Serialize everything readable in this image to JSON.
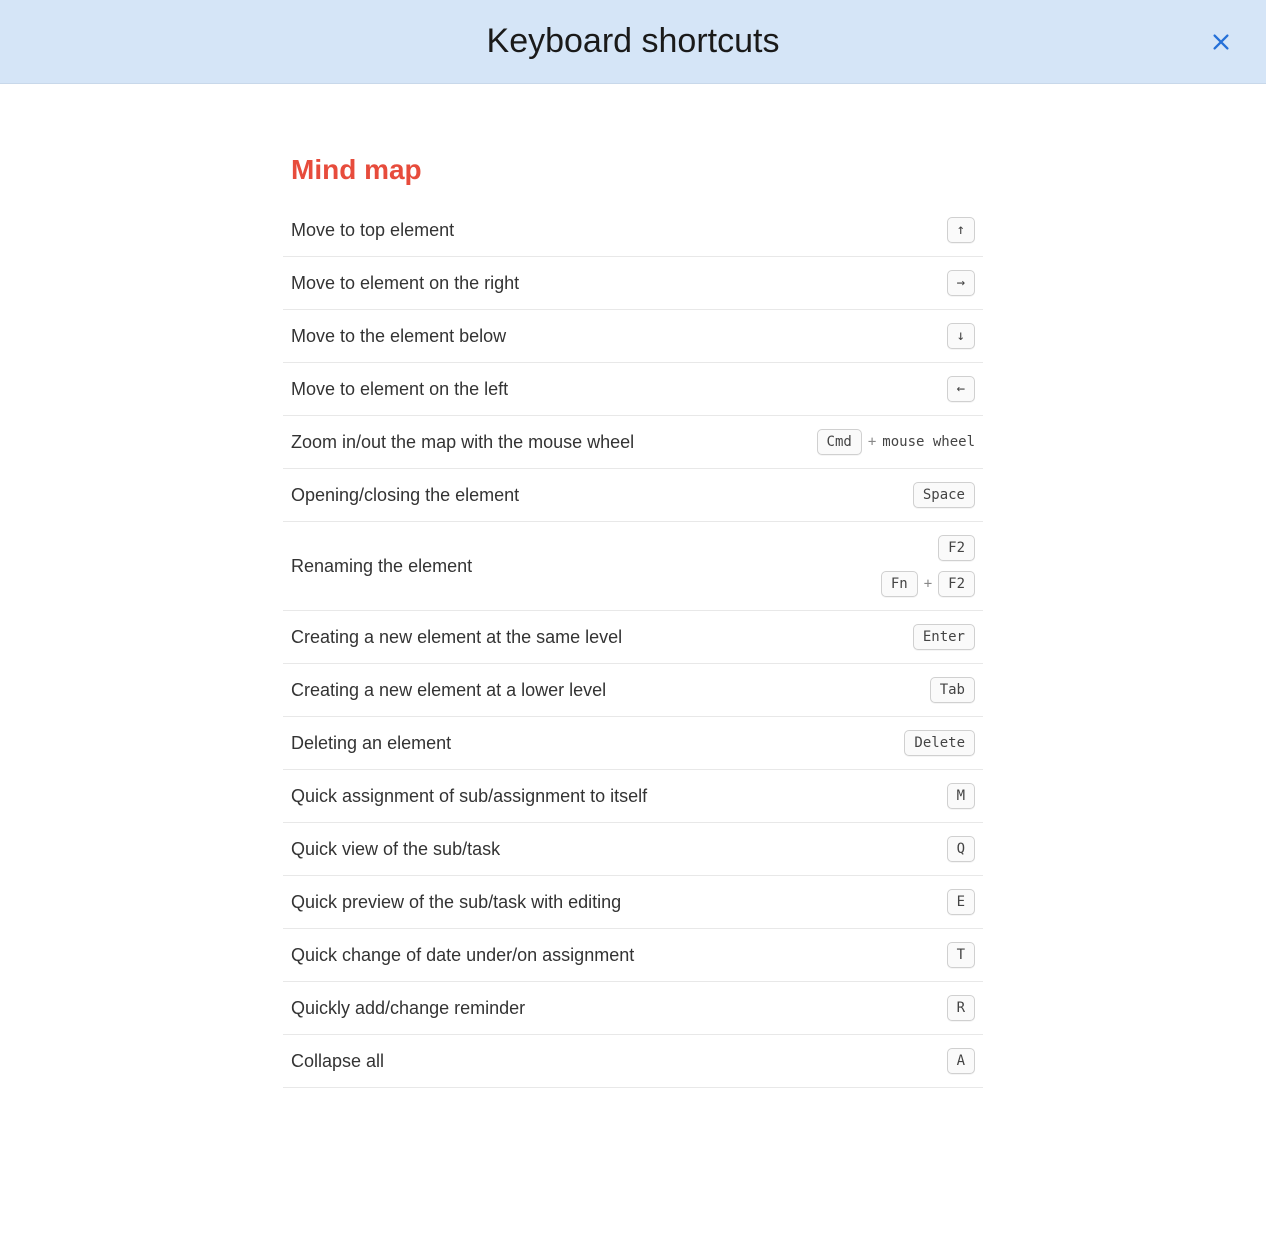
{
  "header": {
    "title": "Keyboard shortcuts"
  },
  "section": {
    "title": "Mind map"
  },
  "shortcuts": [
    {
      "label": "Move to top element",
      "combos": [
        [
          {
            "t": "key",
            "v": "↑"
          }
        ]
      ]
    },
    {
      "label": "Move to element on the right",
      "combos": [
        [
          {
            "t": "key",
            "v": "→"
          }
        ]
      ]
    },
    {
      "label": "Move to the element below",
      "combos": [
        [
          {
            "t": "key",
            "v": "↓"
          }
        ]
      ]
    },
    {
      "label": "Move to element on the left",
      "combos": [
        [
          {
            "t": "key",
            "v": "←"
          }
        ]
      ]
    },
    {
      "label": "Zoom in/out the map with the mouse wheel",
      "combos": [
        [
          {
            "t": "key",
            "v": "Cmd"
          },
          {
            "t": "plus",
            "v": "+"
          },
          {
            "t": "plain",
            "v": "mouse wheel"
          }
        ]
      ]
    },
    {
      "label": "Opening/closing the element",
      "combos": [
        [
          {
            "t": "key",
            "v": "Space"
          }
        ]
      ]
    },
    {
      "label": "Renaming the element",
      "combos": [
        [
          {
            "t": "key",
            "v": "F2"
          }
        ],
        [
          {
            "t": "key",
            "v": "Fn"
          },
          {
            "t": "plus",
            "v": "+"
          },
          {
            "t": "key",
            "v": "F2"
          }
        ]
      ]
    },
    {
      "label": "Creating a new element at the same level",
      "combos": [
        [
          {
            "t": "key",
            "v": "Enter"
          }
        ]
      ]
    },
    {
      "label": "Creating a new element at a lower level",
      "combos": [
        [
          {
            "t": "key",
            "v": "Tab"
          }
        ]
      ]
    },
    {
      "label": "Deleting an element",
      "combos": [
        [
          {
            "t": "key",
            "v": "Delete"
          }
        ]
      ]
    },
    {
      "label": "Quick assignment of sub/assignment to itself",
      "combos": [
        [
          {
            "t": "key",
            "v": "M"
          }
        ]
      ]
    },
    {
      "label": "Quick view of the sub/task",
      "combos": [
        [
          {
            "t": "key",
            "v": "Q"
          }
        ]
      ]
    },
    {
      "label": "Quick preview of the sub/task with editing",
      "combos": [
        [
          {
            "t": "key",
            "v": "E"
          }
        ]
      ]
    },
    {
      "label": "Quick change of date under/on assignment",
      "combos": [
        [
          {
            "t": "key",
            "v": "T"
          }
        ]
      ]
    },
    {
      "label": "Quickly add/change reminder",
      "combos": [
        [
          {
            "t": "key",
            "v": "R"
          }
        ]
      ]
    },
    {
      "label": "Collapse all",
      "combos": [
        [
          {
            "t": "key",
            "v": "A"
          }
        ]
      ]
    }
  ]
}
